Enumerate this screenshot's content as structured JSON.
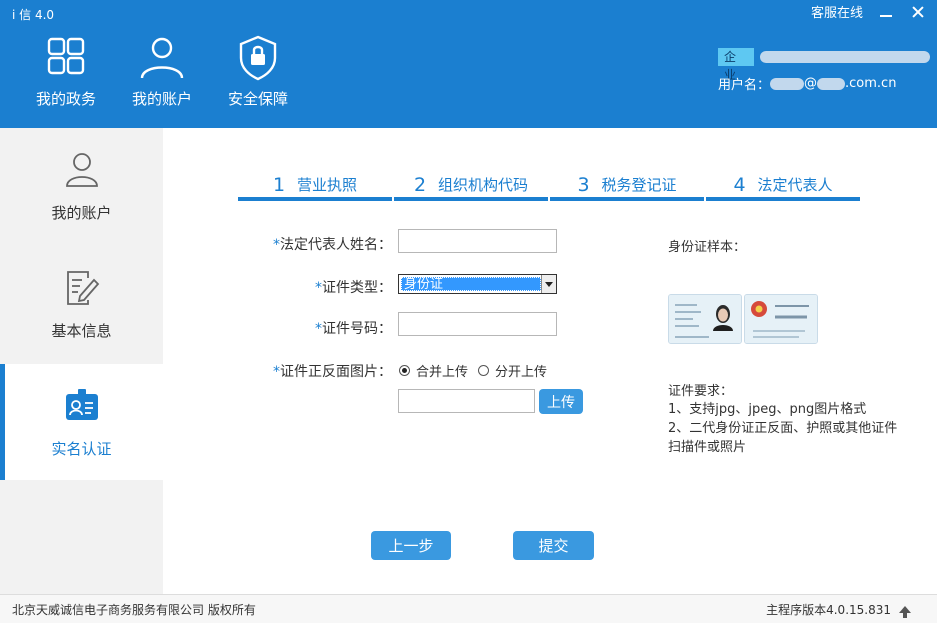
{
  "app": {
    "title": "i 信 4.0"
  },
  "window": {
    "service_label": "客服在线"
  },
  "nav": [
    {
      "label": "我的政务",
      "icon": "grid-icon"
    },
    {
      "label": "我的账户",
      "icon": "user-icon"
    },
    {
      "label": "安全保障",
      "icon": "shield-icon"
    }
  ],
  "user": {
    "badge": "企业",
    "username_label": "用户名：",
    "email_at": "@",
    "email_suffix": ".com.cn"
  },
  "sidebar": [
    {
      "label": "我的账户",
      "icon": "person-icon"
    },
    {
      "label": "基本信息",
      "icon": "edit-document-icon"
    },
    {
      "label": "实名认证",
      "icon": "id-badge-icon"
    }
  ],
  "steps": [
    {
      "num": "1",
      "label": "营业执照"
    },
    {
      "num": "2",
      "label": "组织机构代码"
    },
    {
      "num": "3",
      "label": "税务登记证"
    },
    {
      "num": "4",
      "label": "法定代表人"
    }
  ],
  "form": {
    "required_mark": "*",
    "name_label": "法定代表人姓名：",
    "name_value": "",
    "id_type_label": "证件类型：",
    "id_type_value": "身份证",
    "id_number_label": "证件号码：",
    "id_number_value": "",
    "photo_label": "证件正反面图片：",
    "radio_combined": "合并上传",
    "radio_separate": "分开上传",
    "upload_path_value": "",
    "upload_button": "上传"
  },
  "info": {
    "sample_title": "身份证样本：",
    "requirements_title": "证件要求：",
    "requirements": [
      "1、支持jpg、jpeg、png图片格式",
      "2、二代身份证正反面、护照或其他证件扫描件或照片"
    ]
  },
  "buttons": {
    "prev": "上一步",
    "submit": "提交"
  },
  "footer": {
    "copyright": "北京天威诚信电子商务服务有限公司 版权所有",
    "version": "主程序版本4.0.15.831"
  },
  "colors": {
    "primary": "#1b7fd0",
    "button": "#3a99e0",
    "badge": "#5ec8f2"
  }
}
